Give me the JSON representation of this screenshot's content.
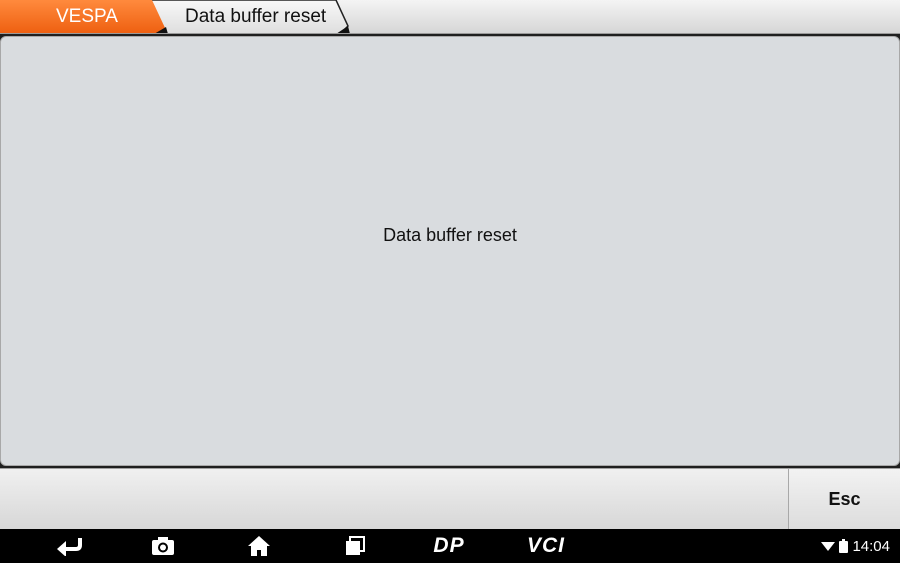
{
  "breadcrumb": {
    "items": [
      {
        "label": "VESPA"
      },
      {
        "label": "Data buffer reset"
      }
    ]
  },
  "main": {
    "message": "Data buffer reset"
  },
  "action_bar": {
    "esc_label": "Esc"
  },
  "nav_bar": {
    "dp_label": "DP",
    "vci_label": "VCI",
    "icons": [
      "back-icon",
      "camera-icon",
      "home-icon",
      "recent-apps-icon",
      "wifi-icon",
      "battery-icon"
    ]
  },
  "status": {
    "time": "14:04"
  },
  "colors": {
    "accent": "#f26b1d",
    "panel": "#d9dcdf",
    "nav_bar": "#000000"
  }
}
